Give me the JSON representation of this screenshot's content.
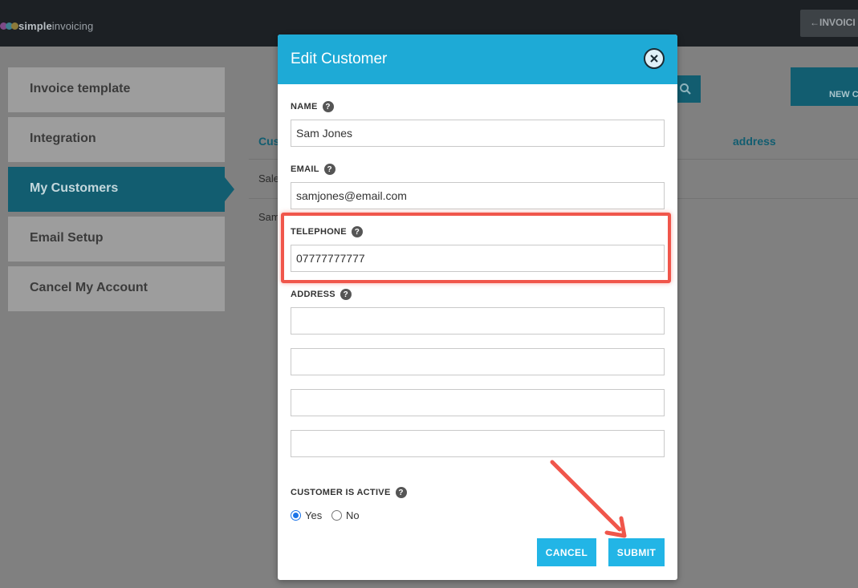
{
  "app": {
    "logo_prefix": "simple",
    "logo_suffix": "invoicing",
    "invoices_button": "INVOICI"
  },
  "sidebar": {
    "items": [
      {
        "label": "Invoice template"
      },
      {
        "label": "Integration"
      },
      {
        "label": "My Customers"
      },
      {
        "label": "Email Setup"
      },
      {
        "label": "Cancel My Account"
      }
    ]
  },
  "main": {
    "new_button": "NEW C",
    "columns": [
      "Cus",
      "address"
    ],
    "rows": [
      "Sale",
      "Sam"
    ]
  },
  "modal": {
    "title": "Edit Customer",
    "name_label": "NAME",
    "name_value": "Sam Jones",
    "email_label": "EMAIL",
    "email_value": "samjones@email.com",
    "telephone_label": "TELEPHONE",
    "telephone_value": "07777777777",
    "address_label": "ADDRESS",
    "address_lines": [
      "",
      "",
      "",
      ""
    ],
    "active_label": "CUSTOMER IS ACTIVE",
    "yes_label": "Yes",
    "no_label": "No",
    "active_selected": "Yes",
    "cancel_label": "CANCEL",
    "submit_label": "SUBMIT",
    "help_glyph": "?"
  },
  "colors": {
    "modal_header": "#1eaad6",
    "button": "#22b5e6",
    "annotation": "#f0564b"
  }
}
